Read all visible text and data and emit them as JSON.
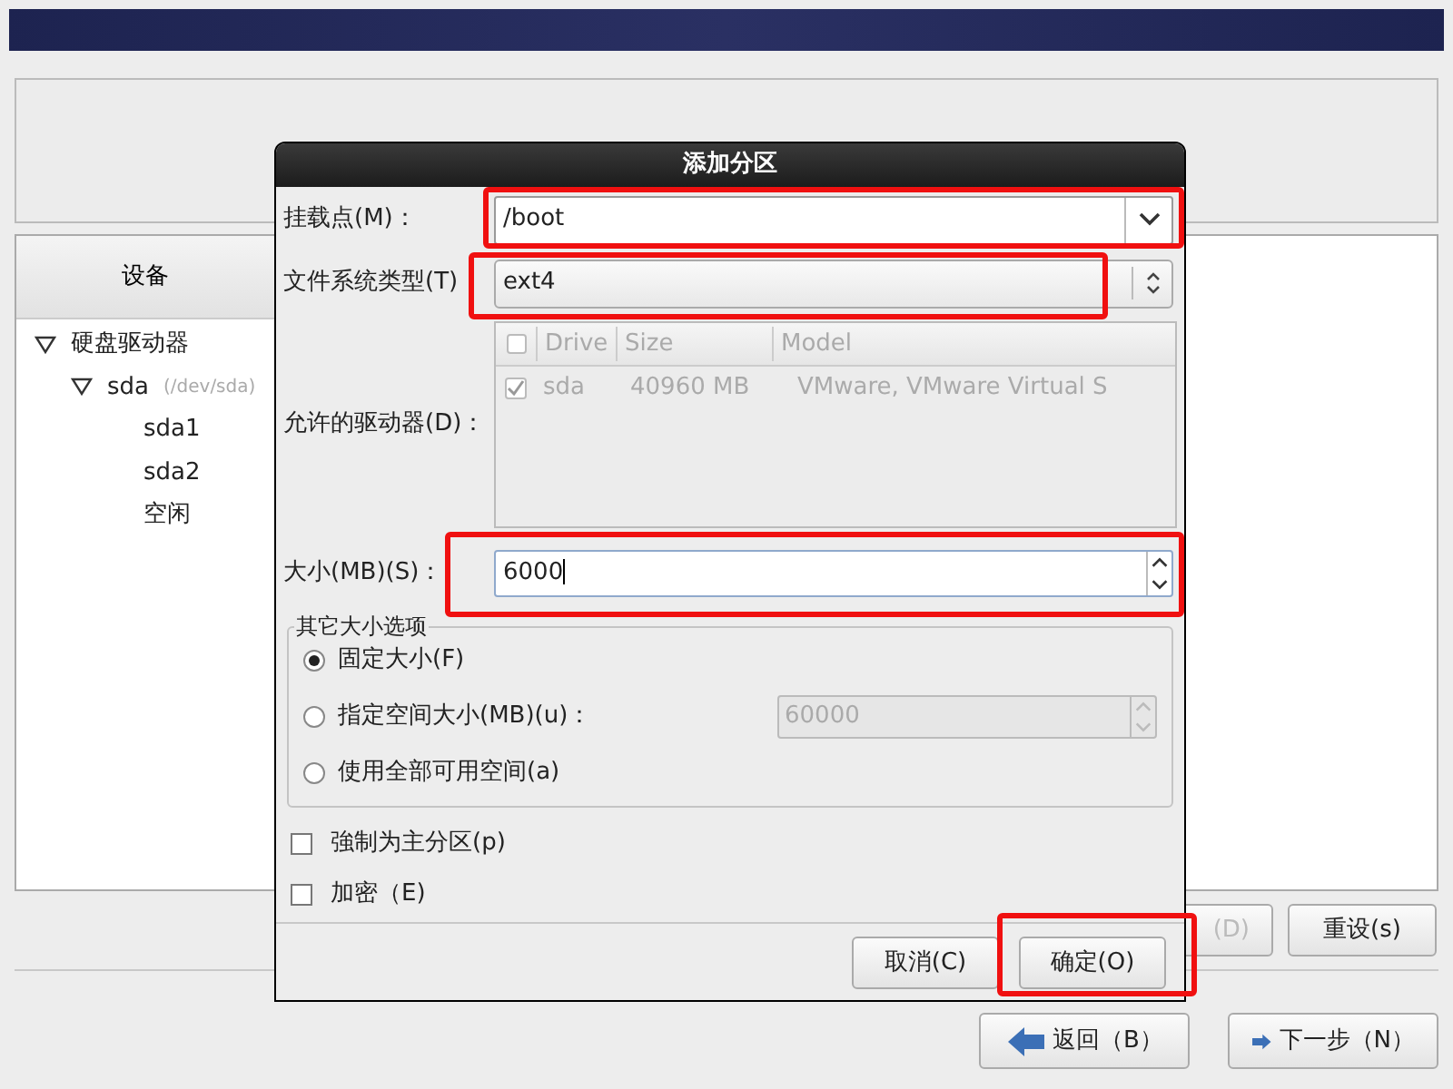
{
  "page": {
    "tree": {
      "column": "设备",
      "items": [
        {
          "label": "硬盘驱动器",
          "expanded": true,
          "children": [
            {
              "label": "sda",
              "hint": "(/dev/sda)",
              "expanded": true,
              "children": [
                {
                  "label": "sda1"
                },
                {
                  "label": "sda2"
                },
                {
                  "label": "空闲"
                }
              ]
            }
          ]
        }
      ]
    },
    "buttons": [
      {
        "label": "(D)",
        "disabled": true
      },
      {
        "label": "重设(s)",
        "disabled": false
      }
    ],
    "nav": [
      {
        "label": "返回（B）",
        "kind": "back"
      },
      {
        "label": "下一步（N）",
        "kind": "next"
      }
    ]
  },
  "dialog": {
    "title": "添加分区",
    "mount_point": {
      "label": "挂载点(M)：",
      "value": "/boot",
      "highlighted": true
    },
    "fs_type": {
      "label": "文件系统类型(T)",
      "value": "ext4",
      "highlighted": true
    },
    "drives": {
      "label": "允许的驱动器(D)：",
      "disabled": true,
      "columns": [
        "Drive",
        "Size",
        "Model"
      ],
      "rows": [
        {
          "checked": true,
          "drive": "sda",
          "size": "40960 MB",
          "model": "VMware, VMware Virtual S"
        }
      ]
    },
    "size": {
      "label": "大小(MB)(S)：",
      "value": "6000",
      "highlighted": true
    },
    "size_options": {
      "title": "其它大小选项",
      "options": [
        {
          "label": "固定大小(F)",
          "selected": true
        },
        {
          "label": "指定空间大小(MB)(u)：",
          "selected": false,
          "field": {
            "value": "60000",
            "disabled": true
          }
        },
        {
          "label": "使用全部可用空间(a)",
          "selected": false
        }
      ]
    },
    "checkboxes": [
      {
        "label": "強制为主分区(p)",
        "checked": false
      },
      {
        "label": "加密（E)",
        "checked": false
      }
    ],
    "buttons": [
      {
        "label": "取消(C)",
        "highlighted": false
      },
      {
        "label": "确定(O)",
        "highlighted": true
      }
    ]
  }
}
